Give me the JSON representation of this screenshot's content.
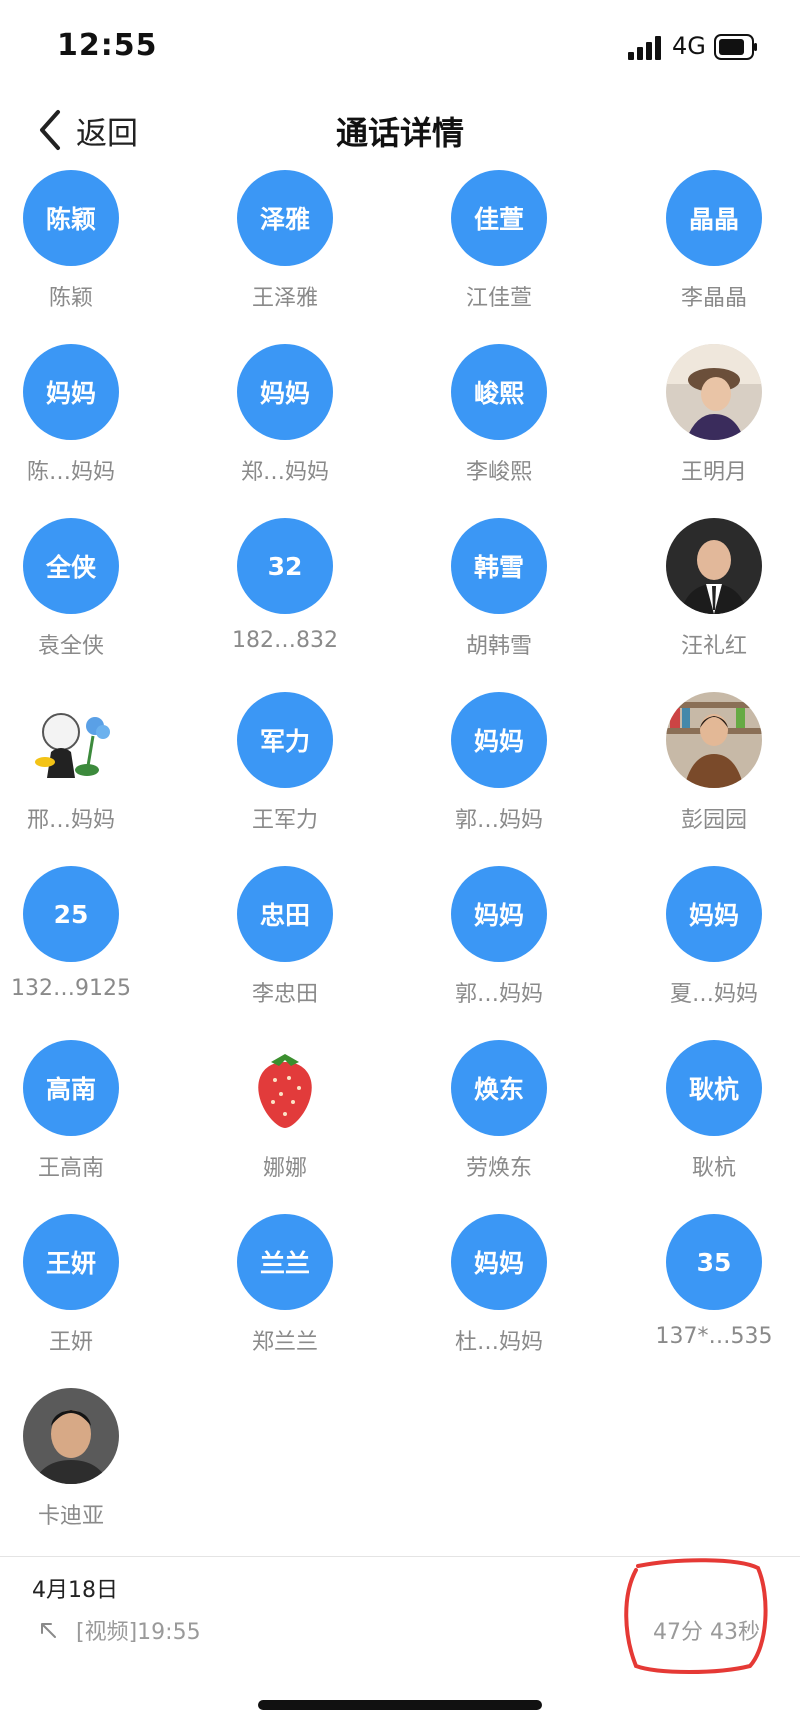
{
  "status_bar": {
    "time": "12:55",
    "network": "4G"
  },
  "nav": {
    "back_label": "返回",
    "title": "通话详情"
  },
  "participants": [
    {
      "avatar_text": "陈颖",
      "name": "陈颖",
      "type": "text"
    },
    {
      "avatar_text": "泽雅",
      "name": "王泽雅",
      "type": "text"
    },
    {
      "avatar_text": "佳萱",
      "name": "江佳萱",
      "type": "text"
    },
    {
      "avatar_text": "晶晶",
      "name": "李晶晶",
      "type": "text"
    },
    {
      "avatar_text": "妈妈",
      "name": "陈…妈妈",
      "type": "text"
    },
    {
      "avatar_text": "妈妈",
      "name": "郑…妈妈",
      "type": "text"
    },
    {
      "avatar_text": "峻熙",
      "name": "李峻熙",
      "type": "text"
    },
    {
      "avatar_text": "",
      "name": "王明月",
      "type": "photo",
      "icon": "woman-cap-photo"
    },
    {
      "avatar_text": "全侠",
      "name": "袁全侠",
      "type": "text"
    },
    {
      "avatar_text": "32",
      "name": "182…832",
      "type": "text"
    },
    {
      "avatar_text": "韩雪",
      "name": "胡韩雪",
      "type": "text"
    },
    {
      "avatar_text": "",
      "name": "汪礼红",
      "type": "photo",
      "icon": "man-suit-photo"
    },
    {
      "avatar_text": "",
      "name": "邢…妈妈",
      "type": "photo",
      "icon": "cartoon-girl-flower-photo"
    },
    {
      "avatar_text": "军力",
      "name": "王军力",
      "type": "text"
    },
    {
      "avatar_text": "妈妈",
      "name": "郭…妈妈",
      "type": "text"
    },
    {
      "avatar_text": "",
      "name": "彭园园",
      "type": "photo",
      "icon": "woman-library-photo"
    },
    {
      "avatar_text": "25",
      "name": "132…9125",
      "type": "text"
    },
    {
      "avatar_text": "忠田",
      "name": "李忠田",
      "type": "text"
    },
    {
      "avatar_text": "妈妈",
      "name": "郭…妈妈",
      "type": "text"
    },
    {
      "avatar_text": "妈妈",
      "name": "夏…妈妈",
      "type": "text"
    },
    {
      "avatar_text": "高南",
      "name": "王高南",
      "type": "text"
    },
    {
      "avatar_text": "",
      "name": "娜娜",
      "type": "photo",
      "icon": "strawberry-photo"
    },
    {
      "avatar_text": "焕东",
      "name": "劳焕东",
      "type": "text"
    },
    {
      "avatar_text": "耿杭",
      "name": "耿杭",
      "type": "text"
    },
    {
      "avatar_text": "王妍",
      "name": "王妍",
      "type": "text"
    },
    {
      "avatar_text": "兰兰",
      "name": "郑兰兰",
      "type": "text"
    },
    {
      "avatar_text": "妈妈",
      "name": "杜…妈妈",
      "type": "text"
    },
    {
      "avatar_text": "35",
      "name": "137*…535",
      "type": "text"
    },
    {
      "avatar_text": "",
      "name": "卡迪亚",
      "type": "photo",
      "icon": "man-portrait-photo"
    }
  ],
  "call": {
    "date": "4月18日",
    "type_time": "[视频]19:55",
    "duration": "47分 43秒",
    "direction_icon": "outgoing-arrow-icon"
  },
  "colors": {
    "avatar_blue": "#3b97f5",
    "annotation_red": "#e53935"
  }
}
